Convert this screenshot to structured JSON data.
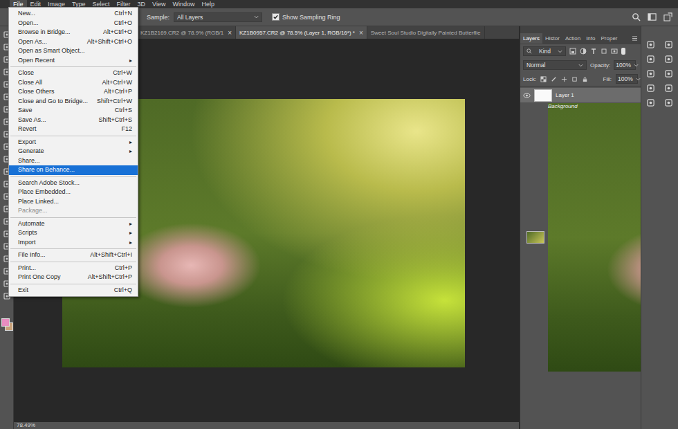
{
  "menubar": [
    {
      "label": "File",
      "selected": true
    },
    {
      "label": "Edit",
      "selected": false
    },
    {
      "label": "Image",
      "selected": false
    },
    {
      "label": "Type",
      "selected": false
    },
    {
      "label": "Select",
      "selected": false
    },
    {
      "label": "Filter",
      "selected": false
    },
    {
      "label": "3D",
      "selected": false
    },
    {
      "label": "View",
      "selected": false
    },
    {
      "label": "Window",
      "selected": false
    },
    {
      "label": "Help",
      "selected": false
    }
  ],
  "options_bar": {
    "sample_label": "Sample:",
    "sample_value": "All Layers",
    "sampling_ring": {
      "label": "Show Sampling Ring",
      "checked": true
    }
  },
  "document_tabs": {
    "close_glyph": "×",
    "tabs": [
      {
        "label": "KZ1B2169.CR2 @ 78.9% (RGB/1",
        "selected": false,
        "closable": true
      },
      {
        "label": "KZ1B0957.CR2 @ 78.5% (Layer 1, RGB/16*) *",
        "selected": true,
        "closable": true
      },
      {
        "label": "Sweet Soul Studio Digitally Painted Butterflie",
        "selected": false,
        "closable": false
      }
    ]
  },
  "swatches": {
    "foreground": "#e98dc0",
    "background": "#c9a27a"
  },
  "file_menu": {
    "submenu_arrow": "▸",
    "groups": [
      [
        {
          "label": "New...",
          "shortcut": "Ctrl+N",
          "submenu": false,
          "disabled": false,
          "selected": false
        },
        {
          "label": "Open...",
          "shortcut": "Ctrl+O",
          "submenu": false,
          "disabled": false,
          "selected": false
        },
        {
          "label": "Browse in Bridge...",
          "shortcut": "Alt+Ctrl+O",
          "submenu": false,
          "disabled": false,
          "selected": false
        },
        {
          "label": "Open As...",
          "shortcut": "Alt+Shift+Ctrl+O",
          "submenu": false,
          "disabled": false,
          "selected": false
        },
        {
          "label": "Open as Smart Object...",
          "shortcut": "",
          "submenu": false,
          "disabled": false,
          "selected": false
        },
        {
          "label": "Open Recent",
          "shortcut": "",
          "submenu": true,
          "disabled": false,
          "selected": false
        }
      ],
      [
        {
          "label": "Close",
          "shortcut": "Ctrl+W",
          "submenu": false,
          "disabled": false,
          "selected": false
        },
        {
          "label": "Close All",
          "shortcut": "Alt+Ctrl+W",
          "submenu": false,
          "disabled": false,
          "selected": false
        },
        {
          "label": "Close Others",
          "shortcut": "Alt+Ctrl+P",
          "submenu": false,
          "disabled": false,
          "selected": false
        },
        {
          "label": "Close and Go to Bridge...",
          "shortcut": "Shift+Ctrl+W",
          "submenu": false,
          "disabled": false,
          "selected": false
        },
        {
          "label": "Save",
          "shortcut": "Ctrl+S",
          "submenu": false,
          "disabled": false,
          "selected": false
        },
        {
          "label": "Save As...",
          "shortcut": "Shift+Ctrl+S",
          "submenu": false,
          "disabled": false,
          "selected": false
        },
        {
          "label": "Revert",
          "shortcut": "F12",
          "submenu": false,
          "disabled": false,
          "selected": false
        }
      ],
      [
        {
          "label": "Export",
          "shortcut": "",
          "submenu": true,
          "disabled": false,
          "selected": false
        },
        {
          "label": "Generate",
          "shortcut": "",
          "submenu": true,
          "disabled": false,
          "selected": false
        },
        {
          "label": "Share...",
          "shortcut": "",
          "submenu": false,
          "disabled": false,
          "selected": false
        },
        {
          "label": "Share on Behance...",
          "shortcut": "",
          "submenu": false,
          "disabled": false,
          "selected": true
        }
      ],
      [
        {
          "label": "Search Adobe Stock...",
          "shortcut": "",
          "submenu": false,
          "disabled": false,
          "selected": false
        },
        {
          "label": "Place Embedded...",
          "shortcut": "",
          "submenu": false,
          "disabled": false,
          "selected": false
        },
        {
          "label": "Place Linked...",
          "shortcut": "",
          "submenu": false,
          "disabled": false,
          "selected": false
        },
        {
          "label": "Package...",
          "shortcut": "",
          "submenu": false,
          "disabled": true,
          "selected": false
        }
      ],
      [
        {
          "label": "Automate",
          "shortcut": "",
          "submenu": true,
          "disabled": false,
          "selected": false
        },
        {
          "label": "Scripts",
          "shortcut": "",
          "submenu": true,
          "disabled": false,
          "selected": false
        },
        {
          "label": "Import",
          "shortcut": "",
          "submenu": true,
          "disabled": false,
          "selected": false
        }
      ],
      [
        {
          "label": "File Info...",
          "shortcut": "Alt+Shift+Ctrl+I",
          "submenu": false,
          "disabled": false,
          "selected": false
        }
      ],
      [
        {
          "label": "Print...",
          "shortcut": "Ctrl+P",
          "submenu": false,
          "disabled": false,
          "selected": false
        },
        {
          "label": "Print One Copy",
          "shortcut": "Alt+Shift+Ctrl+P",
          "submenu": false,
          "disabled": false,
          "selected": false
        }
      ],
      [
        {
          "label": "Exit",
          "shortcut": "Ctrl+Q",
          "submenu": false,
          "disabled": false,
          "selected": false
        }
      ]
    ]
  },
  "layers_panel": {
    "tabs": [
      {
        "label": "Layers",
        "selected": true
      },
      {
        "label": "Histor",
        "selected": false
      },
      {
        "label": "Action",
        "selected": false
      },
      {
        "label": "Info",
        "selected": false
      },
      {
        "label": "Proper",
        "selected": false
      }
    ],
    "filter": "Kind",
    "blend_mode": "Normal",
    "opacity_label": "Opacity:",
    "opacity": "100%",
    "lock_label": "Lock:",
    "fill_label": "Fill:",
    "fill": "100%",
    "layers": [
      {
        "name": "Layer 1",
        "selected": true,
        "visible": true,
        "locked": false,
        "kind": "blank"
      },
      {
        "name": "Background",
        "selected": false,
        "visible": true,
        "locked": true,
        "kind": "photo"
      }
    ]
  },
  "status_bar": {
    "zoom": "78.49%"
  }
}
